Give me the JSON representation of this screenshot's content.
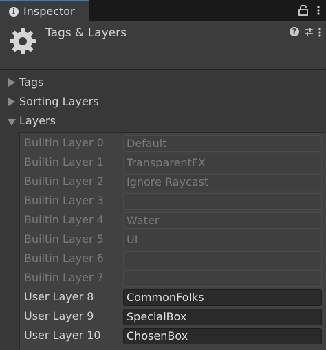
{
  "tab": {
    "title": "Inspector"
  },
  "header": {
    "title": "Tags & Layers"
  },
  "sections": {
    "tags": "Tags",
    "sorting_layers": "Sorting Layers",
    "layers": "Layers"
  },
  "layers": [
    {
      "label": "Builtin Layer 0",
      "value": "Default"
    },
    {
      "label": "Builtin Layer 1",
      "value": "TransparentFX"
    },
    {
      "label": "Builtin Layer 2",
      "value": "Ignore Raycast"
    },
    {
      "label": "Builtin Layer 3",
      "value": ""
    },
    {
      "label": "Builtin Layer 4",
      "value": "Water"
    },
    {
      "label": "Builtin Layer 5",
      "value": "UI"
    },
    {
      "label": "Builtin Layer 6",
      "value": ""
    },
    {
      "label": "Builtin Layer 7",
      "value": ""
    },
    {
      "label": "User Layer 8",
      "value": "CommonFolks"
    },
    {
      "label": "User Layer 9",
      "value": "SpecialBox"
    },
    {
      "label": "User Layer 10",
      "value": "ChosenBox"
    }
  ]
}
